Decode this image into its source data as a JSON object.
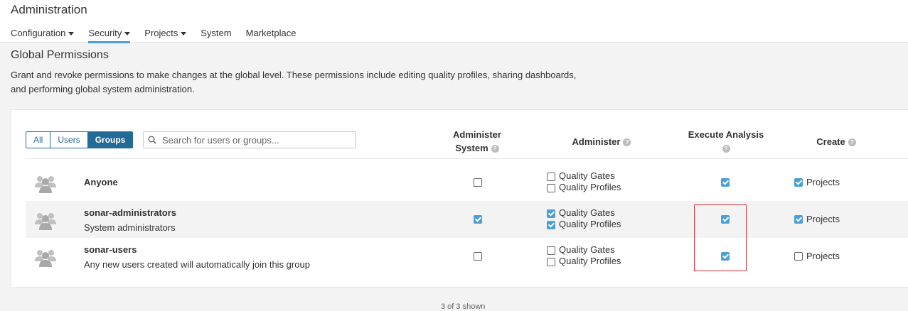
{
  "header": {
    "title": "Administration",
    "nav": [
      {
        "label": "Configuration",
        "caret": true
      },
      {
        "label": "Security",
        "caret": true,
        "active": true
      },
      {
        "label": "Projects",
        "caret": true
      },
      {
        "label": "System",
        "caret": false
      },
      {
        "label": "Marketplace",
        "caret": false
      }
    ]
  },
  "page": {
    "title": "Global Permissions",
    "description_line1": "Grant and revoke permissions to make changes at the global level. These permissions include editing quality profiles, sharing dashboards,",
    "description_line2": "and performing global system administration."
  },
  "filter": {
    "options": [
      "All",
      "Users",
      "Groups"
    ],
    "selected": "Groups"
  },
  "search": {
    "placeholder": "Search for users or groups...",
    "value": ""
  },
  "columns": {
    "administer_system_line1": "Administer",
    "administer_system_line2": "System",
    "administer": "Administer",
    "execute_analysis": "Execute Analysis",
    "create": "Create"
  },
  "permission_labels": {
    "quality_gates": "Quality Gates",
    "quality_profiles": "Quality Profiles",
    "projects": "Projects"
  },
  "rows": [
    {
      "name": "Anyone",
      "description": "",
      "administer_system": false,
      "quality_gates": false,
      "quality_profiles": false,
      "execute_analysis": true,
      "create_projects": true
    },
    {
      "name": "sonar-administrators",
      "description": "System administrators",
      "administer_system": true,
      "quality_gates": true,
      "quality_profiles": true,
      "execute_analysis": true,
      "create_projects": true
    },
    {
      "name": "sonar-users",
      "description": "Any new users created will automatically join this group",
      "administer_system": false,
      "quality_gates": false,
      "quality_profiles": false,
      "execute_analysis": true,
      "create_projects": false
    }
  ],
  "pagination": {
    "text": "3 of 3 shown"
  },
  "icons": {
    "group": "group-icon",
    "search": "search-icon",
    "help": "help-icon"
  },
  "colors": {
    "accent": "#4b9fd5",
    "primary": "#236a97",
    "highlight": "#d02f3a"
  }
}
